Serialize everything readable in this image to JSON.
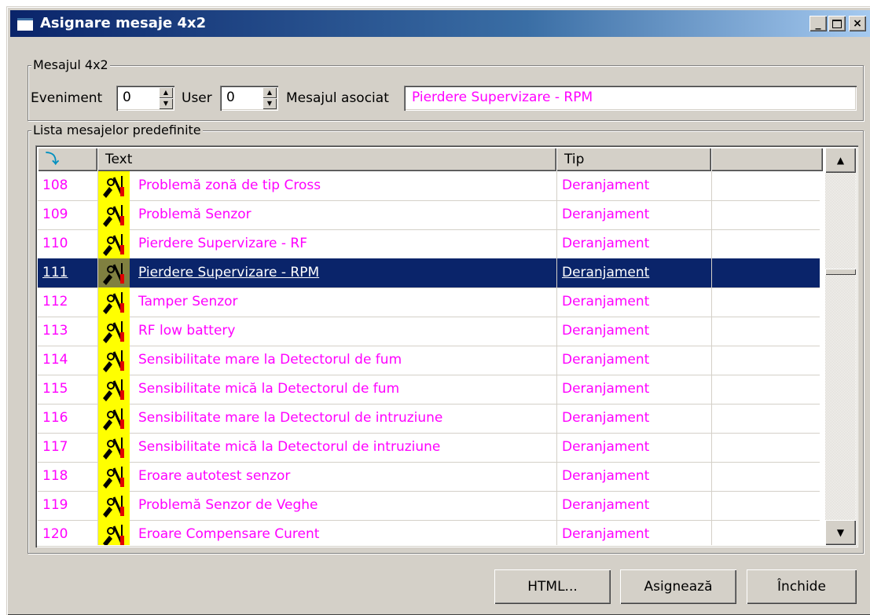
{
  "window": {
    "title": "Asignare mesaje 4x2",
    "controls": [
      "_",
      "□",
      "×"
    ]
  },
  "group1": {
    "label": "Mesajul 4x2",
    "eveniment_label": "Eveniment",
    "eveniment_value": "0",
    "user_label": "User",
    "user_value": "0",
    "mesaj_label": "Mesajul asociat",
    "mesaj_value": "Pierdere Supervizare - RPM"
  },
  "group2": {
    "label": "Lista mesajelor predefinite",
    "columns": [
      "",
      "Text",
      "Tip",
      ""
    ],
    "rows": [
      {
        "id": "108",
        "text": "Problemă zonă de tip Cross",
        "tip": "Deranjament",
        "selected": false
      },
      {
        "id": "109",
        "text": "Problemă Senzor",
        "tip": "Deranjament",
        "selected": false
      },
      {
        "id": "110",
        "text": "Pierdere Supervizare - RF",
        "tip": "Deranjament",
        "selected": false
      },
      {
        "id": "111",
        "text": "Pierdere Supervizare - RPM",
        "tip": "Deranjament",
        "selected": true
      },
      {
        "id": "112",
        "text": "Tamper Senzor",
        "tip": "Deranjament",
        "selected": false
      },
      {
        "id": "113",
        "text": "RF low battery",
        "tip": "Deranjament",
        "selected": false
      },
      {
        "id": "114",
        "text": "Sensibilitate mare la Detectorul de fum",
        "tip": "Deranjament",
        "selected": false
      },
      {
        "id": "115",
        "text": "Sensibilitate mică la Detectorul de fum",
        "tip": "Deranjament",
        "selected": false
      },
      {
        "id": "116",
        "text": "Sensibilitate mare la Detectorul de intruziune",
        "tip": "Deranjament",
        "selected": false
      },
      {
        "id": "117",
        "text": "Sensibilitate mică la Detectorul de intruziune",
        "tip": "Deranjament",
        "selected": false
      },
      {
        "id": "118",
        "text": "Eroare autotest senzor",
        "tip": "Deranjament",
        "selected": false
      },
      {
        "id": "119",
        "text": "Problemă Senzor de Veghe",
        "tip": "Deranjament",
        "selected": false
      },
      {
        "id": "120",
        "text": "Eroare Compensare Curent",
        "tip": "Deranjament",
        "selected": false
      }
    ]
  },
  "buttons": {
    "html": "HTML...",
    "asigneaza": "Asignează",
    "inchide": "Închide"
  },
  "colors": {
    "text_magenta": "#ff00ff",
    "selection": "#0a246a",
    "face": "#d4d0c8",
    "icon_bg": "#ffff00"
  },
  "icons": {
    "title": "window-icon",
    "sort": "sort-arrow-icon",
    "row": "tools-icon"
  }
}
